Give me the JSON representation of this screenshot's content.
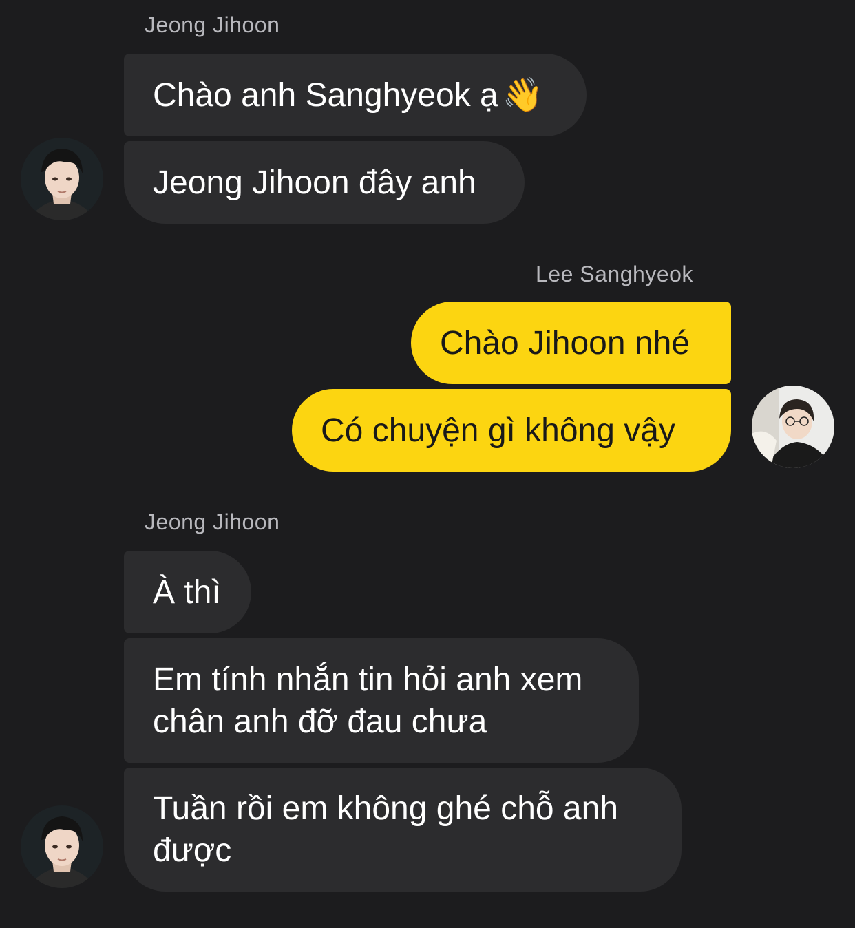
{
  "groups": [
    {
      "sender": "Jeong Jihoon",
      "side": "incoming",
      "messages": [
        "Chào anh Sanghyeok ạ",
        "Jeong Jihoon đây anh"
      ],
      "emoji": "👋"
    },
    {
      "sender": "Lee Sanghyeok",
      "side": "outgoing",
      "messages": [
        "Chào Jihoon nhé",
        "Có chuyện gì không vậy"
      ]
    },
    {
      "sender": "Jeong Jihoon",
      "side": "incoming",
      "messages": [
        "À thì",
        "Em tính nhắn tin hỏi anh xem\nchân anh đỡ đau chưa",
        "Tuần rồi em không ghé chỗ anh\nđược"
      ]
    }
  ],
  "colors": {
    "background": "#1c1c1e",
    "incoming_bubble": "#2c2c2e",
    "outgoing_bubble": "#fcd511",
    "incoming_text": "#ffffff",
    "outgoing_text": "#191919",
    "name_text": "#b8b8bd"
  }
}
